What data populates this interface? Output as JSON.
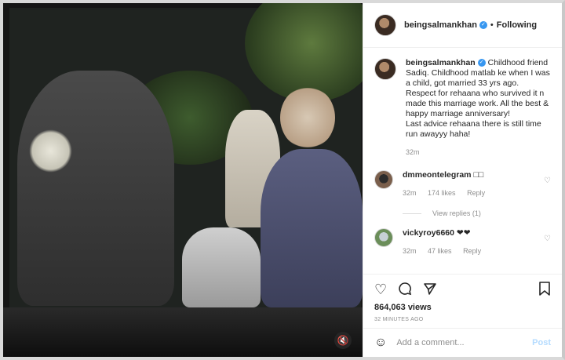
{
  "post": {
    "username": "beingsalmankhan",
    "follow_status": "Following",
    "separator": "•",
    "caption": "Childhood friend Sadiq. Childhood matlab ke when I was a child, got married 33 yrs ago. Respect for rehaana who survived it n made this marriage work. All the best & happy marriage anniversary!",
    "caption_line2": "Last advice rehaana there is still time run awayyy haha!",
    "caption_time": "32m",
    "views": "864,063 views",
    "posted_ago": "32 MINUTES AGO"
  },
  "comments": [
    {
      "username": "dmmeontelegram",
      "text": "□□",
      "time": "32m",
      "likes": "174 likes",
      "reply": "Reply",
      "view_replies": "View replies (1)"
    },
    {
      "username": "vickyroy6660",
      "text": "❤❤",
      "time": "32m",
      "likes": "47 likes",
      "reply": "Reply"
    }
  ],
  "icons": {
    "like": "heart-icon",
    "comment": "comment-icon",
    "share": "share-icon",
    "save": "bookmark-icon",
    "sound": "muted-icon",
    "emoji": "emoji-icon"
  },
  "comment_box": {
    "placeholder": "Add a comment...",
    "post_label": "Post"
  },
  "colors": {
    "verified": "#3897f0",
    "post_disabled": "#b3dbff",
    "muted_text": "#8e8e8e"
  }
}
